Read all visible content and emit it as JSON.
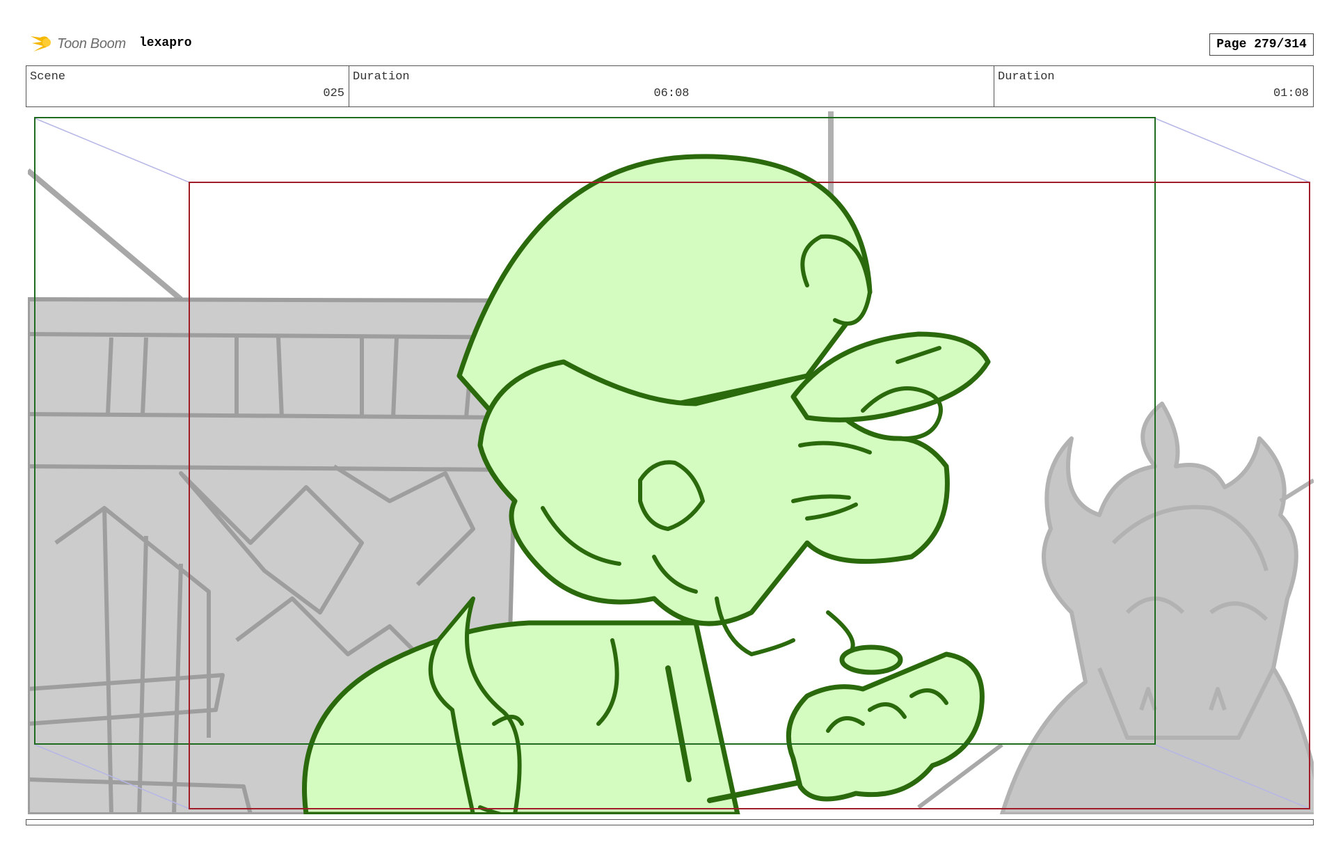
{
  "header": {
    "brand": "Toon Boom",
    "project": "lexapro",
    "page_label": "Page 279/314"
  },
  "scene_table": {
    "scene_label": "Scene",
    "scene_value": "025",
    "duration_label": "Duration",
    "duration_value": "06:08",
    "panel_duration_label": "Duration",
    "panel_duration_value": "01:08"
  },
  "colors": {
    "character_fill": "#d4fcc0",
    "character_line": "#2b6a0c",
    "background_fill": "#cccccc",
    "background_line": "#9e9e9e",
    "safe_frame": "#1f6b1f",
    "camera_frame": "#a01c28",
    "perspective_line": "#b6b6e6"
  }
}
